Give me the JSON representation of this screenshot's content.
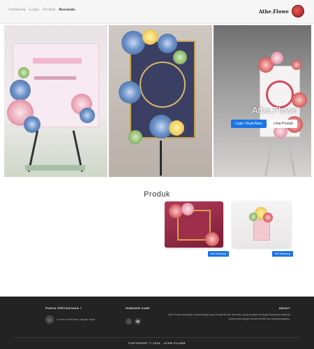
{
  "navbar": {
    "links": [
      "Beranda",
      "Produk",
      "Login",
      "Testimoni"
    ],
    "active_link": "Beranda",
    "brand_name": "Athe.Flowe"
  },
  "hero": {
    "title": "Athe.Flowe",
    "primary_button": "Login / Buat Akun",
    "secondary_button": "Lihat Produk"
  },
  "products": {
    "section_title": "Produk",
    "items": [
      {
        "buy_label": "Beli Sekarang"
      },
      {
        "buy_label": "Beli Sekarang"
      }
    ]
  },
  "footer": {
    "about_heading": "ABOUT",
    "about_text": "Athe.Flowe merupakan usaha bunga papan bunga kertas, dekorasi, yang melayani berbagai kebutuhan dekorasi acara anda dengan desain terbaik dan harga terjangkau.",
    "contact_heading": "HUBUNGI KAMI",
    "faq_heading": "PUNYA PERTANYAAN ?",
    "faq_number": "0",
    "faq_text": "A: Kirim ke DM kami, dengan cepat",
    "copyright": "COPYRIGHT © 2023 - ATHE.FLOWE"
  },
  "colors": {
    "accent": "#1a73e8",
    "footer_bg": "#232323",
    "brand_logo": "#b52a2a"
  }
}
